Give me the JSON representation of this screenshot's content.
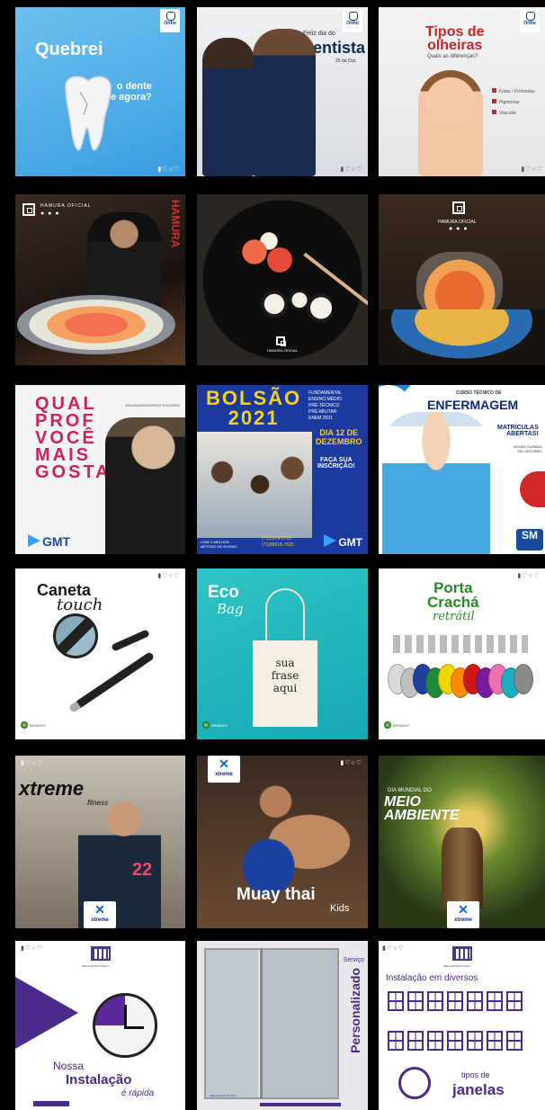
{
  "rows": {
    "row1": {
      "tile1": {
        "brand": "Ortho",
        "headline": "Quebrei",
        "sub": "o dente\ne agora?",
        "icons": "▮♡○♡"
      },
      "tile2": {
        "brand": "Ortho",
        "line1": "Feliz dia do",
        "headline": "Dentista",
        "date": "25 de Out.",
        "icons": "▮♡○♡"
      },
      "tile3": {
        "brand": "Ortho",
        "headline": "Tipos de\nolheiras",
        "sub": "Quais as diferenças?",
        "options": [
          "Fotas / Profundas",
          "Pigmentar",
          "Vascular"
        ],
        "icons": "▮♡○♡"
      }
    },
    "row2": {
      "tile1": {
        "brand": "HAMURA.OFICIAL",
        "sign": "HAMURA"
      },
      "tile2": {
        "brand": "HAMURA.OFICIAL"
      },
      "tile3": {
        "brand": "HAMURA.OFICIAL"
      }
    },
    "row3": {
      "tile1": {
        "hashtag": "#SAUDADEDOSPROFESSORES",
        "headline": "QUAL\nPROF\nVOCÊ\nMAIS\nGOSTA?",
        "logo": "GMT"
      },
      "tile2": {
        "headline": "BOLSÃO\n2021",
        "courses": [
          "FUNDAMENTAL",
          "ENSINO MÉDIO",
          "PRÉ-TÉCNICO",
          "PRÉ-MILITAR",
          "ENEM 2021"
        ],
        "date": "DIA 12 DE\nDEZEMBRO",
        "cta": "FAÇA SUA\nINSCRIÇÃO!",
        "tagline": "COM O MELHOR\nMÉTODO DE ENSINO",
        "phone1": "(71)3379-2720",
        "phone2": "(71)99618-7620",
        "logo": "GMT"
      },
      "tile3": {
        "eyebrow": "CURSO TÉCNICO DE",
        "headline": "ENFERMAGEM",
        "sub": "MATRÍCULAS\nABERTAS!",
        "note": "NOVAS TURMAS\nEM OUTUBRO"
      }
    },
    "row4": {
      "tile1": {
        "headline": "Caneta",
        "script": "touch",
        "brand": "BRINDES",
        "icons": "▮♡○♡"
      },
      "tile2": {
        "headline": "Eco",
        "script": "Bag",
        "bagtext": "sua\nfrase\naqui",
        "brand": "BRINDES"
      },
      "tile3": {
        "headline": "Porta\nCrachá",
        "script": "retrátil",
        "brand": "BRINDES",
        "icons": "▮♡○♡",
        "colors": [
          "#d9d9d9",
          "#bfbfbf",
          "#1e3fa0",
          "#1f8a3a",
          "#f2d400",
          "#ff8c00",
          "#d01818",
          "#7a1aa0",
          "#f06fb0",
          "#18b0c0",
          "#8a8a8a"
        ]
      }
    },
    "row5": {
      "tile1": {
        "headline": "xtreme",
        "sub": "fitness",
        "badge": "xtreme",
        "icons": "▮♡○♡"
      },
      "tile2": {
        "badge": "xtreme",
        "headline": "Muay thai",
        "sub": "Kids",
        "icons": "▮♡○♡"
      },
      "tile3": {
        "line1": "DIA MUNDIAL DO",
        "headline": "MEIO\nAMBIENTE",
        "badge": "xtreme"
      }
    },
    "row6": {
      "tile1": {
        "brand": "MEGA ESTRUTURAS",
        "line1": "Nossa",
        "headline": "Instalação",
        "line3": "é rápida",
        "icons": "▮♡○♡"
      },
      "tile2": {
        "label": "Serviço",
        "headline": "Personalizado",
        "brand": "MEGA ESTRUTURAS"
      },
      "tile3": {
        "brand": "MEGA ESTRUTURAS",
        "line1": "Instalação em diversos",
        "line2": "tipos de",
        "headline": "janelas",
        "icons": "▮♡○♡"
      }
    }
  }
}
